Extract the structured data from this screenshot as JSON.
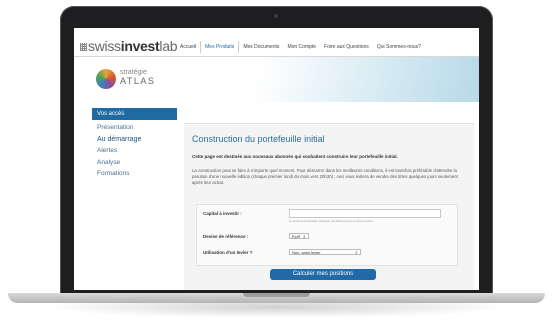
{
  "brand": {
    "logo_prefix": "swiss",
    "logo_bold": "invest",
    "logo_suffix": "lab"
  },
  "topnav": {
    "items": [
      "Accueil",
      "Mes Produits",
      "Mes Documents",
      "Mon Compte",
      "Foire aux Questions",
      "Qui Sommes-nous?"
    ],
    "active": "Mes Produits"
  },
  "banner": {
    "line1": "stratégie",
    "line2": "ATLAS"
  },
  "sidebar": {
    "title": "Vos accès",
    "items": [
      "Présentation",
      "Au démarrage",
      "Alertes",
      "Analyse",
      "Formations"
    ],
    "current": "Au démarrage"
  },
  "main": {
    "heading": "Construction du portefeuille initial",
    "intro": "Cette page est destinée aux nouveaux abonnés qui souhaitent construire leur portefeuille initial.",
    "description": "La construction peut se faire à n'importe quel moment. Pour démarrer dans les meilleures conditions, il est toutefois préférable d'attendre la parution d'une nouvelle édition (chaque premier lundi du mois vers 20h30) ; ceci vous évitera de vendre des titres quelques jours seulement après leur achat.",
    "form": {
      "capital_label": "Capital à investir :",
      "capital_value": "",
      "capital_hint": "Le profil du Portefeuille classique est différent pour ce choix d'option.",
      "currency_label": "Devise de référence :",
      "currency_value": "EUR",
      "leverage_label": "Utilisation d'un levier ?",
      "leverage_value": "Non, sans levier"
    },
    "submit_label": "Calculer mes positions"
  },
  "colors": {
    "accent": "#216aa6",
    "heading": "#2d6e97",
    "sidebar_link": "#4a6f8e"
  }
}
